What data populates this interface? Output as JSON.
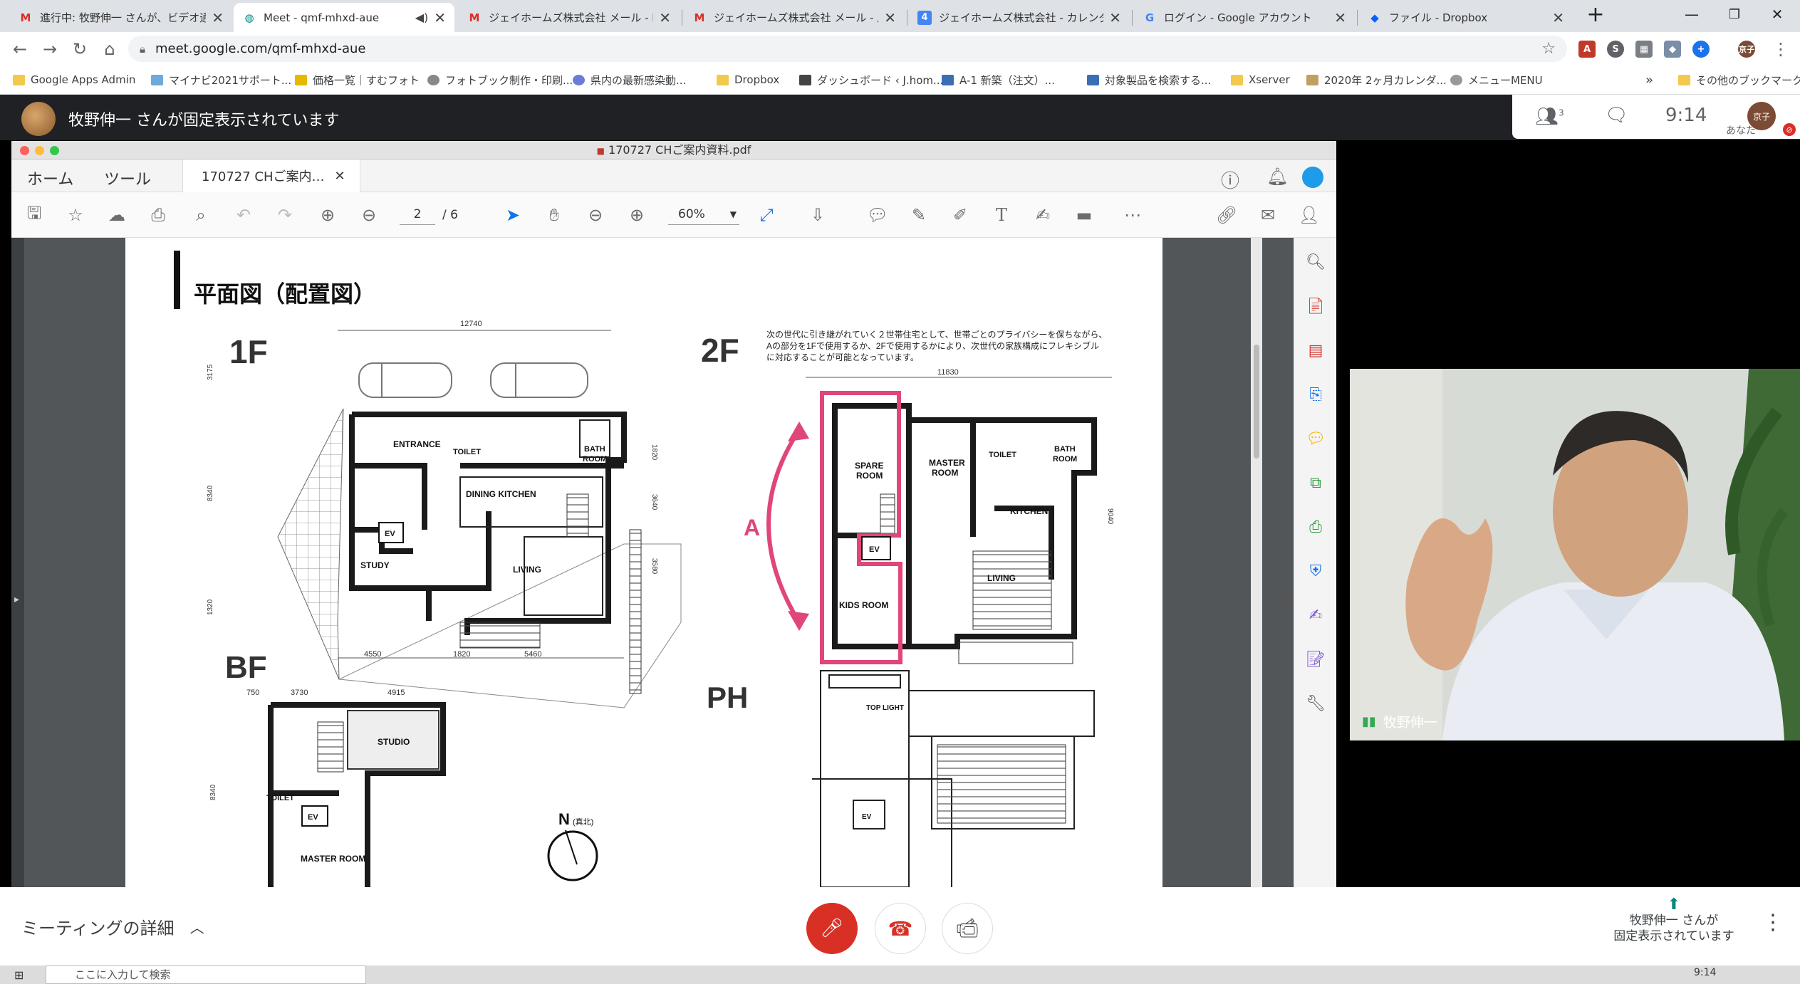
{
  "browser": {
    "tabs": [
      {
        "icon": "gmail-icon",
        "icon_text": "M",
        "icon_color": "#d93025",
        "title": "進行中: 牧野伸一 さんが、ビデオ通話",
        "active": false
      },
      {
        "icon": "meet-icon",
        "icon_text": "●",
        "icon_color": "#00897b",
        "title": "Meet - qmf-mhxd-aue",
        "active": true
      },
      {
        "icon": "gmail-icon",
        "icon_text": "M",
        "icon_color": "#d93025",
        "title": "ジェイホームズ株式会社 メール - Re: [",
        "active": false
      },
      {
        "icon": "gmail-icon",
        "icon_text": "M",
        "icon_color": "#d93025",
        "title": "ジェイホームズ株式会社 メール - 圧縮",
        "active": false
      },
      {
        "icon": "calendar-icon",
        "icon_text": "4",
        "icon_color": "#4285f4",
        "title": "ジェイホームズ株式会社 - カレンダー -",
        "active": false
      },
      {
        "icon": "google-icon",
        "icon_text": "G",
        "icon_color": "#4285f4",
        "title": "ログイン - Google アカウント",
        "active": false
      },
      {
        "icon": "dropbox-icon",
        "icon_text": "◆",
        "icon_color": "#0061fe",
        "title": "ファイル - Dropbox",
        "active": false
      }
    ],
    "url": "meet.google.com/qmf-mhxd-aue",
    "bookmarks": [
      {
        "label": "Google Apps Admin",
        "color": "#f2c94c"
      },
      {
        "label": "マイナビ2021サポート...",
        "color": "#6fa8dc"
      },
      {
        "label": "価格一覧｜すむフォト",
        "color": "#e6b800"
      },
      {
        "label": "フォトブック制作・印刷...",
        "color": "#888888"
      },
      {
        "label": "県内の最新感染動...",
        "color": "#6b7bd6"
      },
      {
        "label": "Dropbox",
        "color": "#f2c94c"
      },
      {
        "label": "ダッシュボード ‹ J.hom...",
        "color": "#444444"
      },
      {
        "label": "A-1 新築（注文）...",
        "color": "#3a6fb5"
      },
      {
        "label": "対象製品を検索する...",
        "color": "#3a6fb5"
      },
      {
        "label": "Xserver",
        "color": "#f2c94c"
      },
      {
        "label": "2020年 2ヶ月カレンダ...",
        "color": "#c0a060"
      },
      {
        "label": "メニューMENU",
        "color": "#999999"
      }
    ],
    "bookmarks_more": "»",
    "other_bookmarks": "その他のブックマーク"
  },
  "meet": {
    "pinned_banner": "牧野伸一 さんが固定表示されています",
    "participants_count": "3",
    "time": "9:14",
    "self_label": "あなた",
    "avatar_text": "京子",
    "video_name": "牧野伸一",
    "meeting_details": "ミーティングの詳細",
    "presenting_line1": "牧野伸一 さんが",
    "presenting_line2": "固定表示されています",
    "taskbar_search": "ここに入力して検索",
    "taskbar_time": "9:14"
  },
  "acrobat": {
    "window_title": "170727 CHご案内資料.pdf",
    "menu_home": "ホーム",
    "menu_tools": "ツール",
    "doc_tab": "170727 CHご案内…",
    "page_current": "2",
    "page_total": "/ 6",
    "zoom": "60%"
  },
  "plan": {
    "heading": "平面図（配置図）",
    "floor_1f": "1F",
    "floor_2f": "2F",
    "floor_bf": "BF",
    "floor_ph": "PH",
    "description_l1": "次の世代に引き継がれていく２世帯住宅として、世帯ごとのプライバシーを保ちながら、",
    "description_l2": "Aの部分を1Fで使用するか、2Fで使用するかにより、次世代の家族構成にフレキシブル",
    "description_l3": "に対応することが可能となっています。",
    "dim_1f_top": "12740",
    "dim_1f_left1": "3175",
    "dim_1f_left2": "8340",
    "dim_1f_left3": "1320",
    "dim_1f_right1": "1820",
    "dim_1f_right2": "3640",
    "dim_1f_right3": "3580",
    "dim_1f_bottom1": "4550",
    "dim_1f_bottom2": "1820",
    "dim_1f_bottom3": "5460",
    "dim_2f_top": "11830",
    "dim_2f_right": "9040",
    "dim_bf_top1": "750",
    "dim_bf_top2": "3730",
    "dim_bf_top3": "4915",
    "dim_bf_left": "8340",
    "room_entrance": "ENTRANCE",
    "room_toilet": "TOILET",
    "room_bath": "BATH",
    "room_room": "ROOM",
    "room_dining": "DINING KITCHEN",
    "room_ev": "EV",
    "room_study": "STUDY",
    "room_living": "LIVING",
    "room_spare": "SPARE",
    "room_master": "MASTER",
    "room_kitchen": "KITCHEN",
    "room_kids": "KIDS ROOM",
    "room_studio": "STUDIO",
    "room_master_room": "MASTER ROOM",
    "room_toplight": "TOP LIGHT",
    "label_a": "A",
    "north": "N",
    "north_sub": "(真北)"
  },
  "colors": {
    "accent_pink": "#e0457b",
    "meet_red": "#d93025",
    "acrobat_red": "#d4332e"
  }
}
